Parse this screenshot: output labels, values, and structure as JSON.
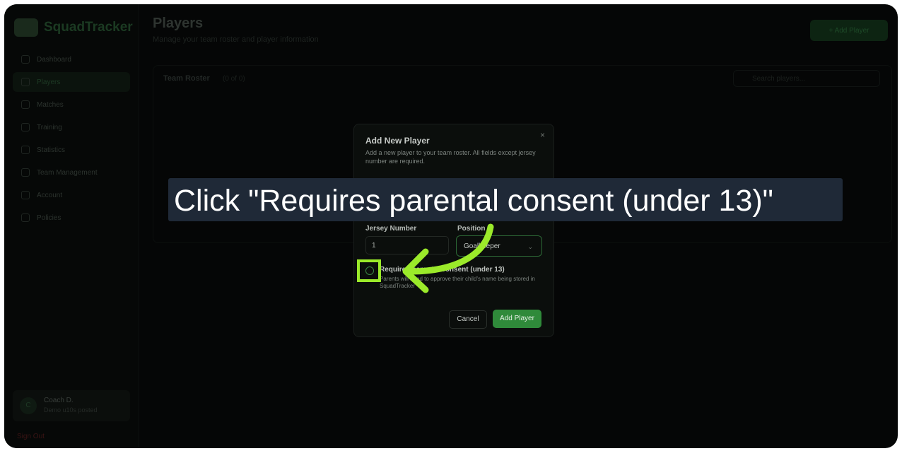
{
  "app": {
    "name": "SquadTracker"
  },
  "sidebar": {
    "items": [
      {
        "label": "Dashboard",
        "icon": "home-icon"
      },
      {
        "label": "Players",
        "icon": "users-icon",
        "active": true
      },
      {
        "label": "Matches",
        "icon": "trophy-icon"
      },
      {
        "label": "Training",
        "icon": "training-icon"
      },
      {
        "label": "Statistics",
        "icon": "chart-icon"
      },
      {
        "label": "Team Management",
        "icon": "team-icon"
      },
      {
        "label": "Account",
        "icon": "user-icon"
      },
      {
        "label": "Policies",
        "icon": "document-icon"
      }
    ],
    "user": {
      "initial": "C",
      "name": "Coach D.",
      "subtitle": "Demo u10s posted"
    },
    "signout": "Sign Out"
  },
  "header": {
    "title": "Players",
    "subtitle": "Manage your team roster and player information",
    "add_button": "+ Add Player"
  },
  "roster": {
    "title": "Team Roster",
    "count": "(0 of 0)",
    "search_placeholder": "Search players..."
  },
  "modal": {
    "title": "Add New Player",
    "description": "Add a new player to your team roster. All fields except jersey number are required.",
    "close": "×",
    "jersey_label": "Jersey Number",
    "jersey_value": "1",
    "position_label": "Position",
    "position_value": "Goalkeeper",
    "consent_label": "Requires parental consent (under 13)",
    "consent_help": "Parents will need to approve their child's name being stored in SquadTracker",
    "cancel": "Cancel",
    "submit": "Add Player"
  },
  "instruction": {
    "text": "Click \"Requires parental consent (under 13)\"",
    "accent": "#9bea2a"
  }
}
